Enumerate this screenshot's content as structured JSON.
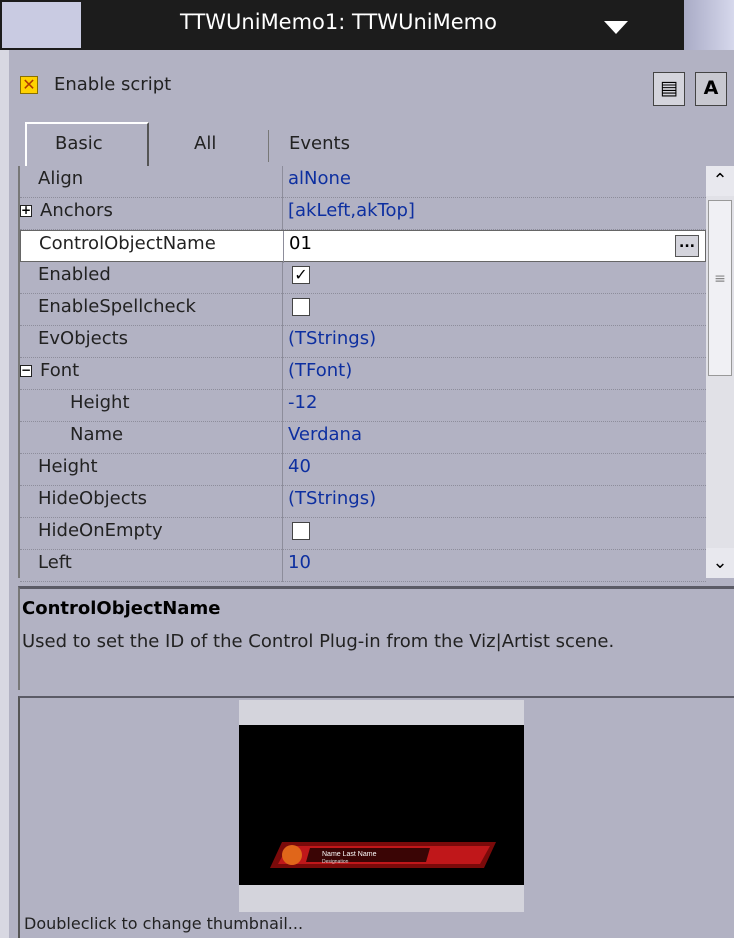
{
  "window": {
    "title": "TTWUniMemo1: TTWUniMemo",
    "dropdown_icon": "triangle-down-icon"
  },
  "toolbar": {
    "enable_script_label": "Enable script",
    "enable_script_checked": true
  },
  "tabs": [
    {
      "label": "Basic",
      "active": true
    },
    {
      "label": "All",
      "active": false
    },
    {
      "label": "Events",
      "active": false
    }
  ],
  "properties": [
    {
      "name": "Align",
      "value": "alNone"
    },
    {
      "name": "Anchors",
      "value": "[akLeft,akTop]",
      "expander": "+"
    },
    {
      "name": "ControlObjectName",
      "value": "01",
      "selected": true
    },
    {
      "name": "Enabled",
      "checkbox": "checked"
    },
    {
      "name": "EnableSpellcheck",
      "checkbox": "unchecked"
    },
    {
      "name": "EvObjects",
      "value": "(TStrings)"
    },
    {
      "name": "Font",
      "value": "(TFont)",
      "expander": "−"
    },
    {
      "name": "Height",
      "value": "-12",
      "sub": true
    },
    {
      "name": "Name",
      "value": "Verdana",
      "sub": true
    },
    {
      "name": "Height",
      "value": "40"
    },
    {
      "name": "HideObjects",
      "value": "(TStrings)"
    },
    {
      "name": "HideOnEmpty",
      "checkbox": "unchecked"
    },
    {
      "name": "Left",
      "value": "10"
    }
  ],
  "selected_property_button": "...",
  "description": {
    "title": "ControlObjectName",
    "body": "Used to set the ID of the Control Plug-in from the Viz|Artist scene."
  },
  "thumbnail": {
    "caption": "Doubleclick to change thumbnail...",
    "lowerthird_name": "Name Last Name",
    "lowerthird_designation": "Designation"
  },
  "colors": {
    "panel_bg": "#b2b2c3",
    "value_text": "#0d2fa0",
    "title_bar": "#1c1c1c"
  }
}
